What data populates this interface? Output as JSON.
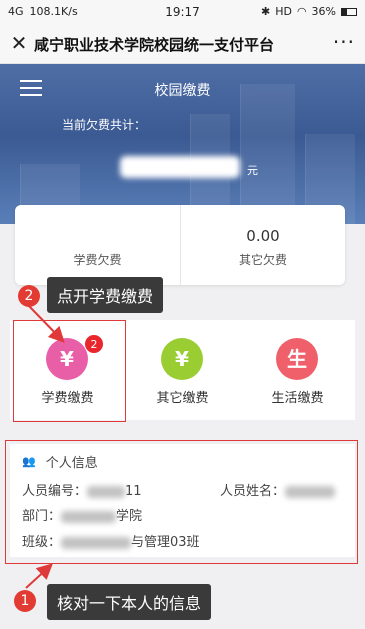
{
  "status_bar": {
    "signal": "4G",
    "speed": "108.1K/s",
    "time": "19:17",
    "battery": "36%",
    "hd": "HD"
  },
  "titlebar": {
    "title": "咸宁职业技术学院校园统一支付平台",
    "close_glyph": "✕",
    "more_glyph": "···"
  },
  "banner": {
    "title": "校园缴费",
    "owed_label": "当前欠费共计：",
    "owed_unit": "元"
  },
  "summary": {
    "tuition_owed_label": "学费欠费",
    "other_owed_value": "0.00",
    "other_owed_label": "其它欠费"
  },
  "tooltip_step2": {
    "number": "2",
    "text": "点开学费缴费"
  },
  "tooltip_step1": {
    "number": "1",
    "text": "核对一下本人的信息"
  },
  "services": [
    {
      "label": "学费缴费",
      "icon": "yen-icon",
      "glyph": "¥",
      "color": "#e85fa8",
      "badge": "2"
    },
    {
      "label": "其它缴费",
      "icon": "yen-icon",
      "glyph": "¥",
      "color": "#9acd32"
    },
    {
      "label": "生活缴费",
      "icon": "shop-icon",
      "glyph": "生",
      "color": "#f0606a"
    }
  ],
  "personal_info": {
    "title": "个人信息",
    "id_label": "人员编号：",
    "id_suffix": "11",
    "name_label": "人员姓名：",
    "dept_label": "部门：",
    "dept_suffix": "学院",
    "class_label": "班级：",
    "class_suffix": "与管理03班"
  },
  "colors": {
    "banner": "#4a68a0",
    "highlight": "#e0393a",
    "tooltip": "#3a3a3a"
  }
}
